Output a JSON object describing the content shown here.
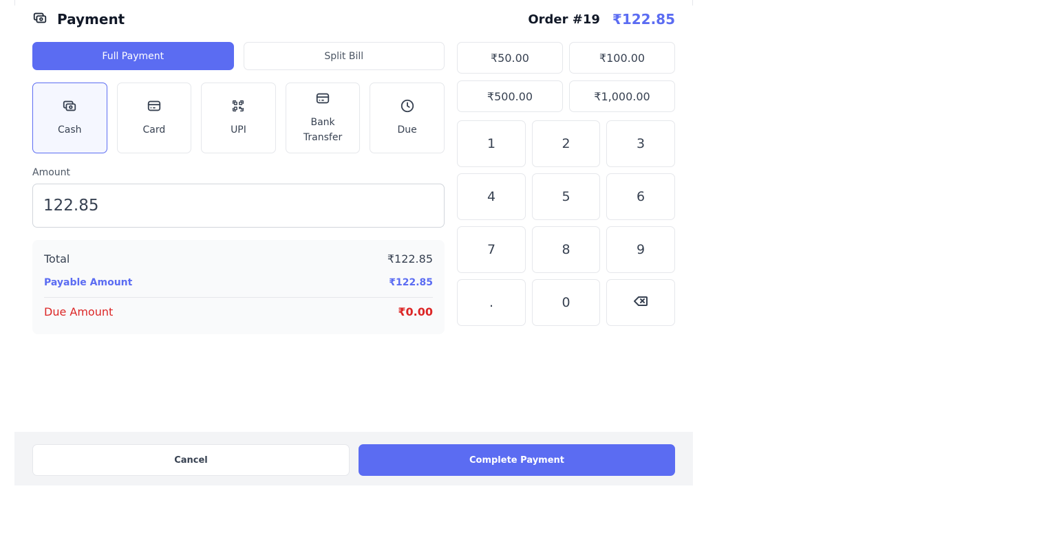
{
  "header": {
    "title": "Payment",
    "order_label": "Order #19",
    "order_total": "₹122.85"
  },
  "tabs": [
    {
      "label": "Full Payment",
      "active": true
    },
    {
      "label": "Split Bill",
      "active": false
    }
  ],
  "methods": [
    {
      "line1": "Cash",
      "line2": "",
      "icon": "cash-icon",
      "active": true
    },
    {
      "line1": "Card",
      "line2": "",
      "icon": "card-icon",
      "active": false
    },
    {
      "line1": "UPI",
      "line2": "",
      "icon": "qr-code-icon",
      "active": false
    },
    {
      "line1": "Bank",
      "line2": "Transfer",
      "icon": "bank-card-icon",
      "active": false
    },
    {
      "line1": "Due",
      "line2": "",
      "icon": "clock-icon",
      "active": false
    }
  ],
  "amount": {
    "label": "Amount",
    "value": "122.85"
  },
  "summary": {
    "total_label": "Total",
    "total_value": "₹122.85",
    "payable_label": "Payable Amount",
    "payable_value": "₹122.85",
    "due_label": "Due Amount",
    "due_value": "₹0.00"
  },
  "quick_amounts": [
    "₹50.00",
    "₹100.00",
    "₹500.00",
    "₹1,000.00"
  ],
  "keypad": [
    "1",
    "2",
    "3",
    "4",
    "5",
    "6",
    "7",
    "8",
    "9",
    ".",
    "0"
  ],
  "footer": {
    "cancel_label": "Cancel",
    "complete_label": "Complete Payment"
  },
  "colors": {
    "accent": "#5b6cf2",
    "danger": "#dc2626"
  }
}
